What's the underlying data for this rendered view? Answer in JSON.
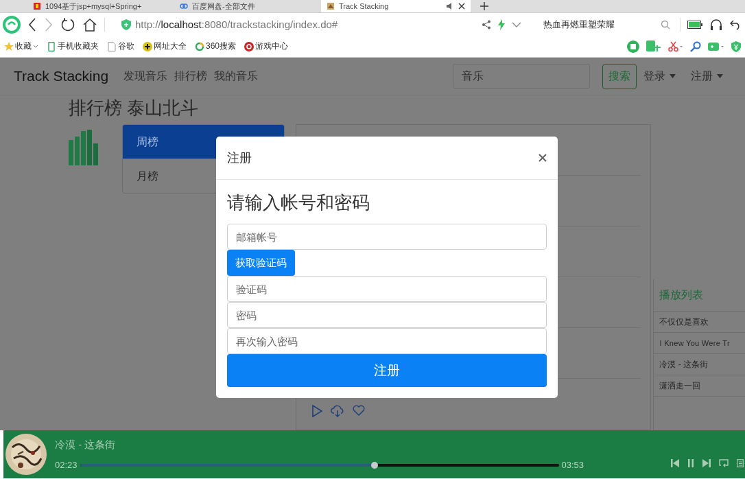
{
  "browser": {
    "tabs": [
      {
        "title": "1094基于jsp+mysql+Spring+",
        "kind": "red",
        "selected": false
      },
      {
        "title": "百度网盘-全部文件",
        "kind": "cloud",
        "selected": false
      },
      {
        "title": "Track Stacking",
        "kind": "thumb",
        "selected": true
      }
    ],
    "address": {
      "scheme": "http://",
      "host": "localhost",
      "path": ":8080/trackstacking/index.do#"
    },
    "search_hint": "热血再燃重塑荣耀",
    "bookmarks": [
      {
        "label": "收藏",
        "kind": "star"
      },
      {
        "label": "手机收藏夹",
        "kind": "phone"
      },
      {
        "label": "谷歌",
        "kind": "page"
      },
      {
        "label": "网址大全",
        "kind": "plus"
      },
      {
        "label": "360搜索",
        "kind": "ring"
      },
      {
        "label": "游戏中心",
        "kind": "game"
      }
    ]
  },
  "navbar": {
    "brand": "Track Stacking",
    "links": [
      "发现音乐",
      "排行榜",
      "我的音乐"
    ],
    "search_placeholder": "音乐",
    "search_button": "搜索",
    "menus": [
      "登录",
      "注册"
    ]
  },
  "heading": "排行榜 泰山北斗",
  "chart_tabs": [
    {
      "label": "周榜",
      "selected": true
    },
    {
      "label": "月榜",
      "selected": false
    }
  ],
  "playlist": {
    "title": "播放列表",
    "items": [
      "不仅仅是喜欢",
      "I Knew You Were Tr",
      "冷漠 - 这条街",
      "潇洒走一回"
    ]
  },
  "player": {
    "title": "冷漠 - 这条街",
    "elapsed": "02:23",
    "duration": "03:53",
    "level": 0.615,
    "playing": true
  },
  "modal": {
    "title": "注册",
    "heading": "请输入帐号和密码",
    "fields": [
      {
        "kind": "input",
        "placeholder": "邮箱帐号"
      },
      {
        "kind": "button",
        "label": "获取验证码"
      },
      {
        "kind": "input",
        "placeholder": "验证码"
      },
      {
        "kind": "input",
        "placeholder": "密码"
      },
      {
        "kind": "input",
        "placeholder": "再次输入密码"
      }
    ],
    "submit": "注册"
  }
}
